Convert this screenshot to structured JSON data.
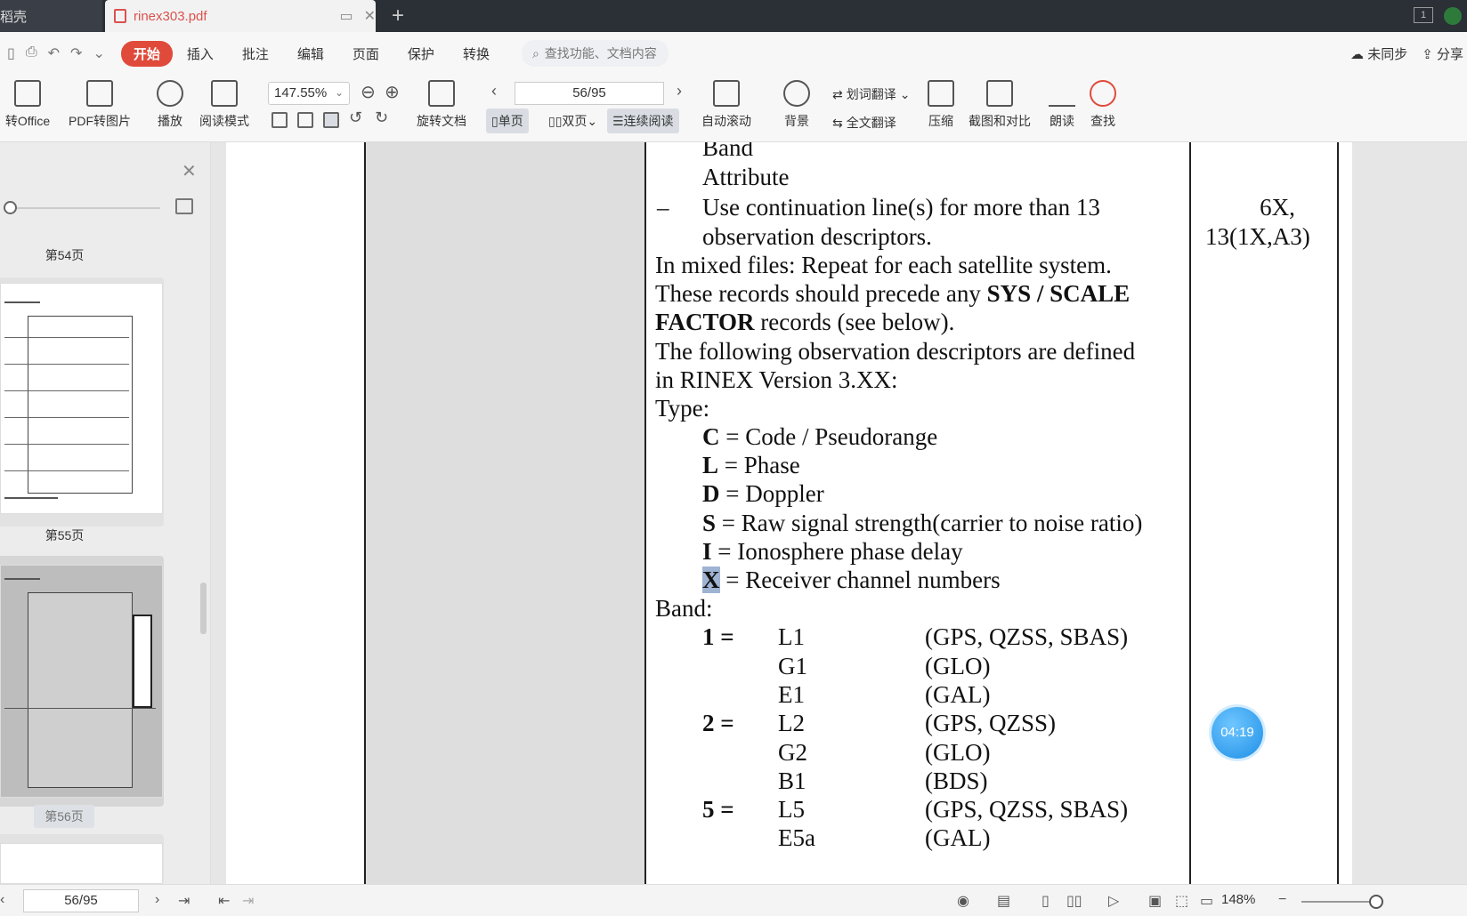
{
  "titlebar": {
    "home_tab": "稻壳",
    "doc_tab": "rinex303.pdf",
    "new_tab": "+"
  },
  "menubar": {
    "items": [
      "开始",
      "插入",
      "批注",
      "编辑",
      "页面",
      "保护",
      "转换"
    ],
    "search_placeholder": "查找功能、文档内容",
    "sync": "未同步",
    "share": "分享"
  },
  "ribbon": {
    "to_office": "转Office",
    "pdf_to_img": "PDF转图片",
    "play": "播放",
    "read_mode": "阅读模式",
    "zoom": "147.55%",
    "rotate_doc": "旋转文档",
    "page_indicator": "56/95",
    "single_page": "单页",
    "double_page": "双页",
    "continuous": "连续阅读",
    "auto_scroll": "自动滚动",
    "background": "背景",
    "word_translate": "划词翻译",
    "full_translate": "全文翻译",
    "compress": "压缩",
    "screenshot_compare": "截图和对比",
    "read_aloud": "朗读",
    "find": "查找"
  },
  "sidebar": {
    "page54": "第54页",
    "page55": "第55页",
    "page56": "第56页"
  },
  "document": {
    "line_band": "Band",
    "line_attribute": "Attribute",
    "dash": "–",
    "line_cont1": "Use continuation line(s) for more than 13",
    "line_cont2": "observation descriptors.",
    "format1": "6X,",
    "format2": "13(1X,A3)",
    "mixed": "In mixed files: Repeat for each satellite system.",
    "precede_a": "These records should precede any ",
    "precede_b": "SYS / SCALE",
    "factor_a": "FACTOR",
    "factor_b": " records (see below).",
    "following": "The following observation descriptors are defined",
    "version": "in RINEX Version 3.XX:",
    "type": "Type:",
    "types": [
      {
        "code": "C",
        "desc": " = Code / Pseudorange"
      },
      {
        "code": "L",
        "desc": " = Phase"
      },
      {
        "code": "D",
        "desc": " = Doppler"
      },
      {
        "code": "S",
        "desc": " = Raw signal strength(carrier to noise ratio)"
      },
      {
        "code": "I",
        "desc": " = Ionosphere phase delay"
      },
      {
        "code": "X",
        "desc": " = Receiver channel numbers"
      }
    ],
    "band": "Band:",
    "bands": [
      {
        "num": "1 =",
        "sig": "L1",
        "sys": "(GPS, QZSS, SBAS)"
      },
      {
        "num": "",
        "sig": "G1",
        "sys": "(GLO)"
      },
      {
        "num": "",
        "sig": "E1",
        "sys": "(GAL)"
      },
      {
        "num": "2 =",
        "sig": "L2",
        "sys": "(GPS, QZSS)"
      },
      {
        "num": "",
        "sig": "G2",
        "sys": "(GLO)"
      },
      {
        "num": "",
        "sig": "B1",
        "sys": "(BDS)"
      },
      {
        "num": "5 =",
        "sig": "L5",
        "sys": "(GPS, QZSS, SBAS)"
      },
      {
        "num": "",
        "sig": "E5a",
        "sys": "(GAL)"
      }
    ]
  },
  "timer": "04:19",
  "statusbar": {
    "page": "56/95",
    "zoom": "148%"
  }
}
